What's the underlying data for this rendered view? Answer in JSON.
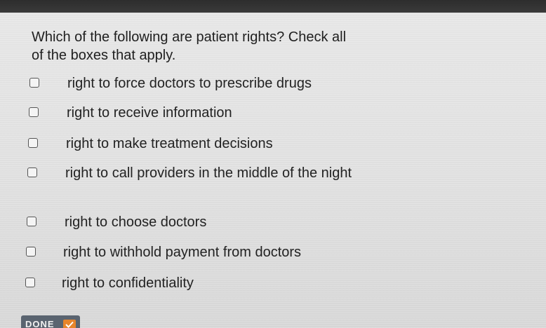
{
  "question": {
    "line1": "Which of the following are patient rights? Check all",
    "line2": "of the boxes that apply."
  },
  "options": [
    {
      "label": "right to force doctors to prescribe drugs",
      "checked": false
    },
    {
      "label": "right to receive information",
      "checked": false
    },
    {
      "label": "right to make treatment decisions",
      "checked": false
    },
    {
      "label": "right to call providers in the middle of the night",
      "checked": false
    },
    {
      "label": "right to choose doctors",
      "checked": false
    },
    {
      "label": "right to withhold payment from doctors",
      "checked": false
    },
    {
      "label": "right to confidentiality",
      "checked": false
    }
  ],
  "done_button": {
    "label": "DONE",
    "icon": "check-icon",
    "color": "#5a6470",
    "accent": "#e8852b"
  }
}
